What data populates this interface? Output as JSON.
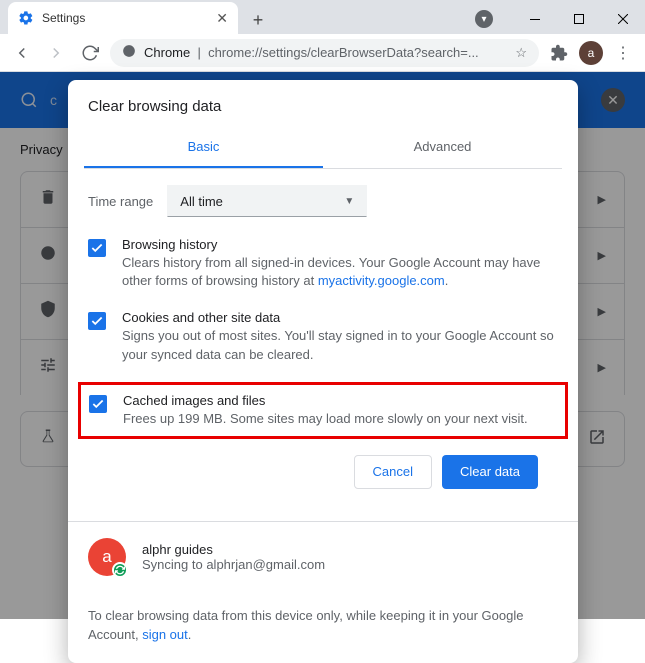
{
  "window": {
    "tab_title": "Settings",
    "omnibox_prefix": "Chrome",
    "omnibox_url": "chrome://settings/clearBrowserData?search=...",
    "avatar_letter": "a"
  },
  "page": {
    "search_hint": "c",
    "section_title": "Privacy"
  },
  "dialog": {
    "title": "Clear browsing data",
    "tabs": {
      "basic": "Basic",
      "advanced": "Advanced"
    },
    "time_label": "Time range",
    "time_value": "All time",
    "items": [
      {
        "title": "Browsing history",
        "desc_pre": "Clears history from all signed-in devices. Your Google Account may have other forms of browsing history at ",
        "desc_link": "myactivity.google.com",
        "desc_post": "."
      },
      {
        "title": "Cookies and other site data",
        "desc": "Signs you out of most sites. You'll stay signed in to your Google Account so your synced data can be cleared."
      },
      {
        "title": "Cached images and files",
        "desc": "Frees up 199 MB. Some sites may load more slowly on your next visit."
      }
    ],
    "cancel": "Cancel",
    "clear": "Clear data",
    "sync": {
      "avatar_letter": "a",
      "name": "alphr guides",
      "status_pre": "Syncing to ",
      "email": "alphrjan@gmail.com"
    },
    "footer_pre": "To clear browsing data from this device only, while keeping it in your Google Account, ",
    "footer_link": "sign out",
    "footer_post": "."
  }
}
